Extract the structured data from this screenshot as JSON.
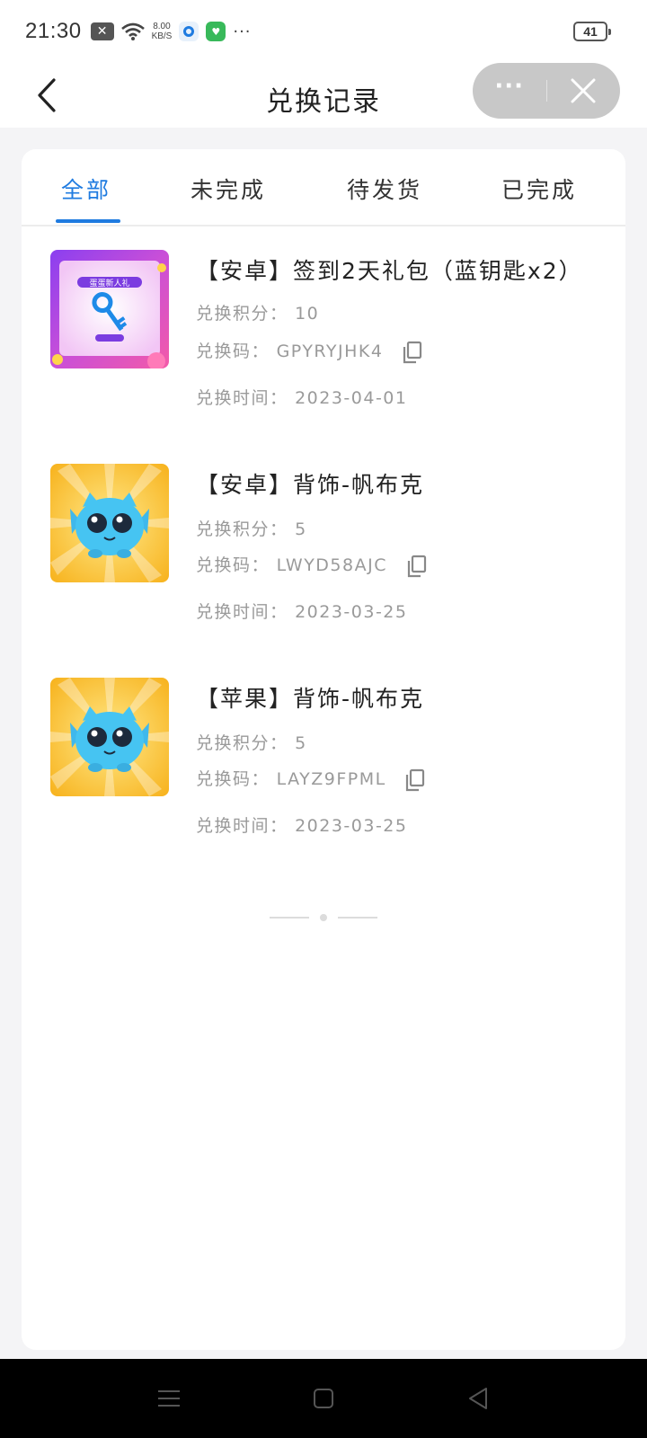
{
  "status_bar": {
    "time": "21:30",
    "notification_icon": "x-badge-icon",
    "net_speed_value": "8.00",
    "net_speed_unit": "KB/S",
    "more": "···",
    "battery": "41"
  },
  "nav": {
    "title": "兑换记录",
    "back_icon": "chevron-left-icon",
    "more_icon": "ellipsis-icon",
    "more_label": "···",
    "close_icon": "close-icon"
  },
  "tabs": [
    {
      "label": "全部",
      "active": true
    },
    {
      "label": "未完成",
      "active": false
    },
    {
      "label": "待发货",
      "active": false
    },
    {
      "label": "已完成",
      "active": false
    }
  ],
  "records": [
    {
      "title": "【安卓】签到2天礼包（蓝钥匙x2）",
      "points_label": "兑换积分：",
      "points": "10",
      "code_label": "兑换码：",
      "code": "GPYRYJHK4",
      "time_label": "兑换时间：",
      "time": "2023-04-01",
      "thumb": "blue-key-giftpack-thumbnail",
      "thumb_text": "蛋蛋新人礼"
    },
    {
      "title": "【安卓】背饰-帆布克",
      "points_label": "兑换积分：",
      "points": "5",
      "code_label": "兑换码：",
      "code": "LWYD58AJC",
      "time_label": "兑换时间：",
      "time": "2023-03-25",
      "thumb": "blue-creature-thumbnail"
    },
    {
      "title": "【苹果】背饰-帆布克",
      "points_label": "兑换积分：",
      "points": "5",
      "code_label": "兑换码：",
      "code": "LAYZ9FPML",
      "time_label": "兑换时间：",
      "time": "2023-03-25",
      "thumb": "blue-creature-thumbnail"
    }
  ],
  "colors": {
    "accent": "#1f7be0",
    "text_primary": "#222222",
    "text_secondary": "#9a9a9a",
    "background": "#f4f4f6",
    "capsule": "#c8c8c8"
  },
  "system_nav": {
    "menu_icon": "menu-icon",
    "home_icon": "home-square-icon",
    "back_icon": "back-triangle-icon"
  }
}
